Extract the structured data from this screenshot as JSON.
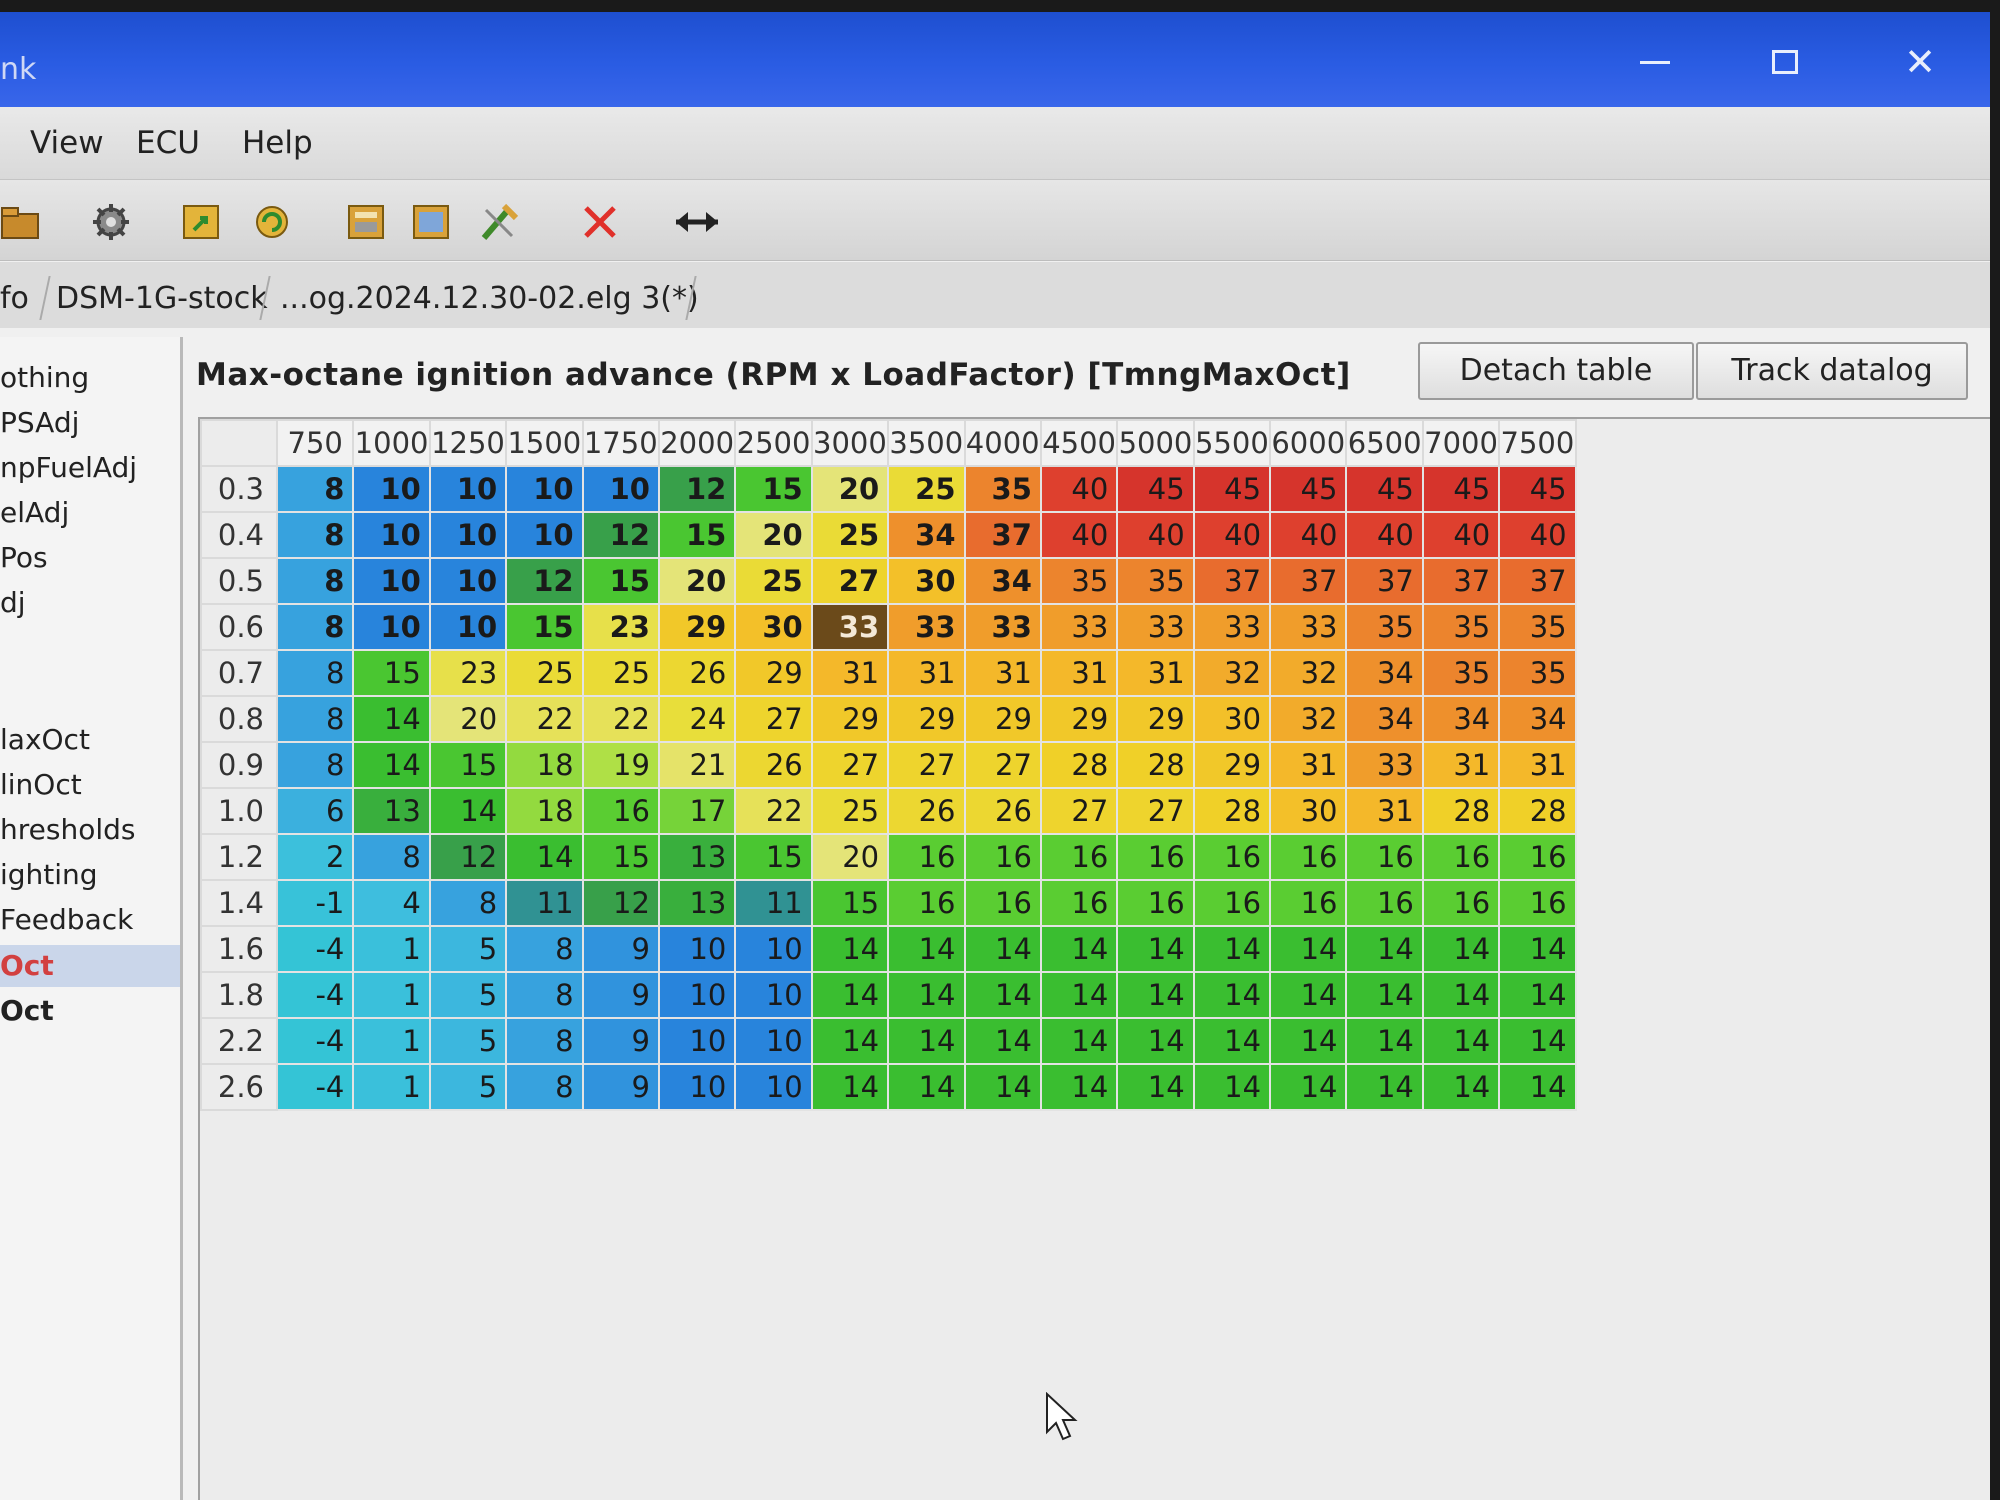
{
  "window": {
    "title": "nk"
  },
  "menu": [
    "View",
    "ECU",
    "Help"
  ],
  "toolbar_icons": [
    "open-folder-icon",
    "settings-gear-icon",
    "load-map-icon",
    "refresh-icon",
    "compare-icon",
    "map-view-icon",
    "tools-icon",
    "close-x-icon",
    "swap-arrows-icon"
  ],
  "tabs": [
    "fo",
    "DSM-1G-stock",
    "...og.2024.12.30-02.elg 3(*)"
  ],
  "sidebar": {
    "items": [
      {
        "label": "othing"
      },
      {
        "label": "PSAdj"
      },
      {
        "label": "npFuelAdj"
      },
      {
        "label": "elAdj"
      },
      {
        "label": "Pos"
      },
      {
        "label": "dj"
      },
      {
        "label": ""
      },
      {
        "label": "laxOct"
      },
      {
        "label": "linOct"
      },
      {
        "label": "hresholds"
      },
      {
        "label": "ighting"
      },
      {
        "label": "Feedback"
      },
      {
        "label": "Oct"
      },
      {
        "label": "Oct"
      }
    ],
    "selected_index": 12
  },
  "table": {
    "title": "Max-octane ignition advance (RPM x LoadFactor) [TmngMaxOct]",
    "detach_label": "Detach table",
    "track_label": "Track datalog",
    "columns": [
      "750",
      "1000",
      "1250",
      "1500",
      "1750",
      "2000",
      "2500",
      "3000",
      "3500",
      "4000",
      "4500",
      "5000",
      "5500",
      "6000",
      "6500",
      "7000",
      "7500"
    ],
    "rows": [
      "0.3",
      "0.4",
      "0.5",
      "0.6",
      "0.7",
      "0.8",
      "0.9",
      "1.0",
      "1.2",
      "1.4",
      "1.6",
      "1.8",
      "2.2",
      "2.6"
    ],
    "values": [
      [
        8,
        10,
        10,
        10,
        10,
        12,
        15,
        20,
        25,
        35,
        40,
        45,
        45,
        45,
        45,
        45,
        45
      ],
      [
        8,
        10,
        10,
        10,
        12,
        15,
        20,
        25,
        34,
        37,
        40,
        40,
        40,
        40,
        40,
        40,
        40
      ],
      [
        8,
        10,
        10,
        12,
        15,
        20,
        25,
        27,
        30,
        34,
        35,
        35,
        37,
        37,
        37,
        37,
        37
      ],
      [
        8,
        10,
        10,
        15,
        23,
        29,
        30,
        33,
        33,
        33,
        33,
        33,
        33,
        33,
        35,
        35,
        35
      ],
      [
        8,
        15,
        23,
        25,
        25,
        26,
        29,
        31,
        31,
        31,
        31,
        31,
        32,
        32,
        34,
        35,
        35
      ],
      [
        8,
        14,
        20,
        22,
        22,
        24,
        27,
        29,
        29,
        29,
        29,
        29,
        30,
        32,
        34,
        34,
        34
      ],
      [
        8,
        14,
        15,
        18,
        19,
        21,
        26,
        27,
        27,
        27,
        28,
        28,
        29,
        31,
        33,
        31,
        31
      ],
      [
        6,
        13,
        14,
        18,
        16,
        17,
        22,
        25,
        26,
        26,
        27,
        27,
        28,
        30,
        31,
        28,
        28
      ],
      [
        2,
        8,
        12,
        14,
        15,
        13,
        15,
        20,
        16,
        16,
        16,
        16,
        16,
        16,
        16,
        16,
        16
      ],
      [
        -1,
        4,
        8,
        11,
        12,
        13,
        11,
        15,
        16,
        16,
        16,
        16,
        16,
        16,
        16,
        16,
        16
      ],
      [
        -4,
        1,
        5,
        8,
        9,
        10,
        10,
        14,
        14,
        14,
        14,
        14,
        14,
        14,
        14,
        14,
        14
      ],
      [
        -4,
        1,
        5,
        8,
        9,
        10,
        10,
        14,
        14,
        14,
        14,
        14,
        14,
        14,
        14,
        14,
        14
      ],
      [
        -4,
        1,
        5,
        8,
        9,
        10,
        10,
        14,
        14,
        14,
        14,
        14,
        14,
        14,
        14,
        14,
        14
      ],
      [
        -4,
        1,
        5,
        8,
        9,
        10,
        10,
        14,
        14,
        14,
        14,
        14,
        14,
        14,
        14,
        14,
        14
      ]
    ],
    "bold_rows": [
      0,
      1,
      2,
      3
    ],
    "highlighted_cell": {
      "row": 3,
      "col": 7
    }
  }
}
